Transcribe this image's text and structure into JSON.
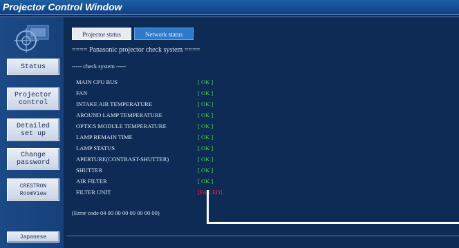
{
  "window": {
    "title": "Projector Control Window"
  },
  "sidebar": {
    "buttons": [
      {
        "label": "Status"
      },
      {
        "label": "Projector\ncontrol"
      },
      {
        "label": "Detailed\nset up"
      },
      {
        "label": "Change\npassword"
      },
      {
        "label": "CRESTRON\nRoomView"
      },
      {
        "label": "Japanese"
      }
    ]
  },
  "tabs": [
    {
      "label": "Projector status",
      "active": true
    },
    {
      "label": "Network status",
      "active": false
    }
  ],
  "main": {
    "header": "==== Panasonic projector check system ====",
    "subheader": "----- check system -----",
    "checks": [
      {
        "label": "MAIN CPU BUS",
        "status": "[ OK ]"
      },
      {
        "label": "FAN",
        "status": "[ OK ]"
      },
      {
        "label": "INTAKE AIR TEMPERATURE",
        "status": "[ OK ]"
      },
      {
        "label": "AROUND LAMP TEMPERATURE",
        "status": "[ OK ]"
      },
      {
        "label": "OPTICS MODULE TEMPERATURE",
        "status": "[ OK ]"
      },
      {
        "label": "LAMP REMAIN TIME",
        "status": "[ OK ]"
      },
      {
        "label": "LAMP STATUS",
        "status": "[ OK ]"
      },
      {
        "label": "APERTURE(CONTRAST-SHUTTER)",
        "status": "[ OK ]"
      },
      {
        "label": "SHUTTER",
        "status": "[ OK ]"
      },
      {
        "label": "AIR FILTER",
        "status": "[ OK ]"
      },
      {
        "label": "FILTER UNIT",
        "status": "[FAILED]"
      }
    ],
    "error_code": "(Error code 04 00 00 00 00 00 00 00)"
  },
  "colors": {
    "background": "#0d2b55",
    "ok": "#4fd24a",
    "failed": "#ff2b2b",
    "active_tab": "#e8ecf2",
    "inactive_tab": "#2f79c9"
  }
}
